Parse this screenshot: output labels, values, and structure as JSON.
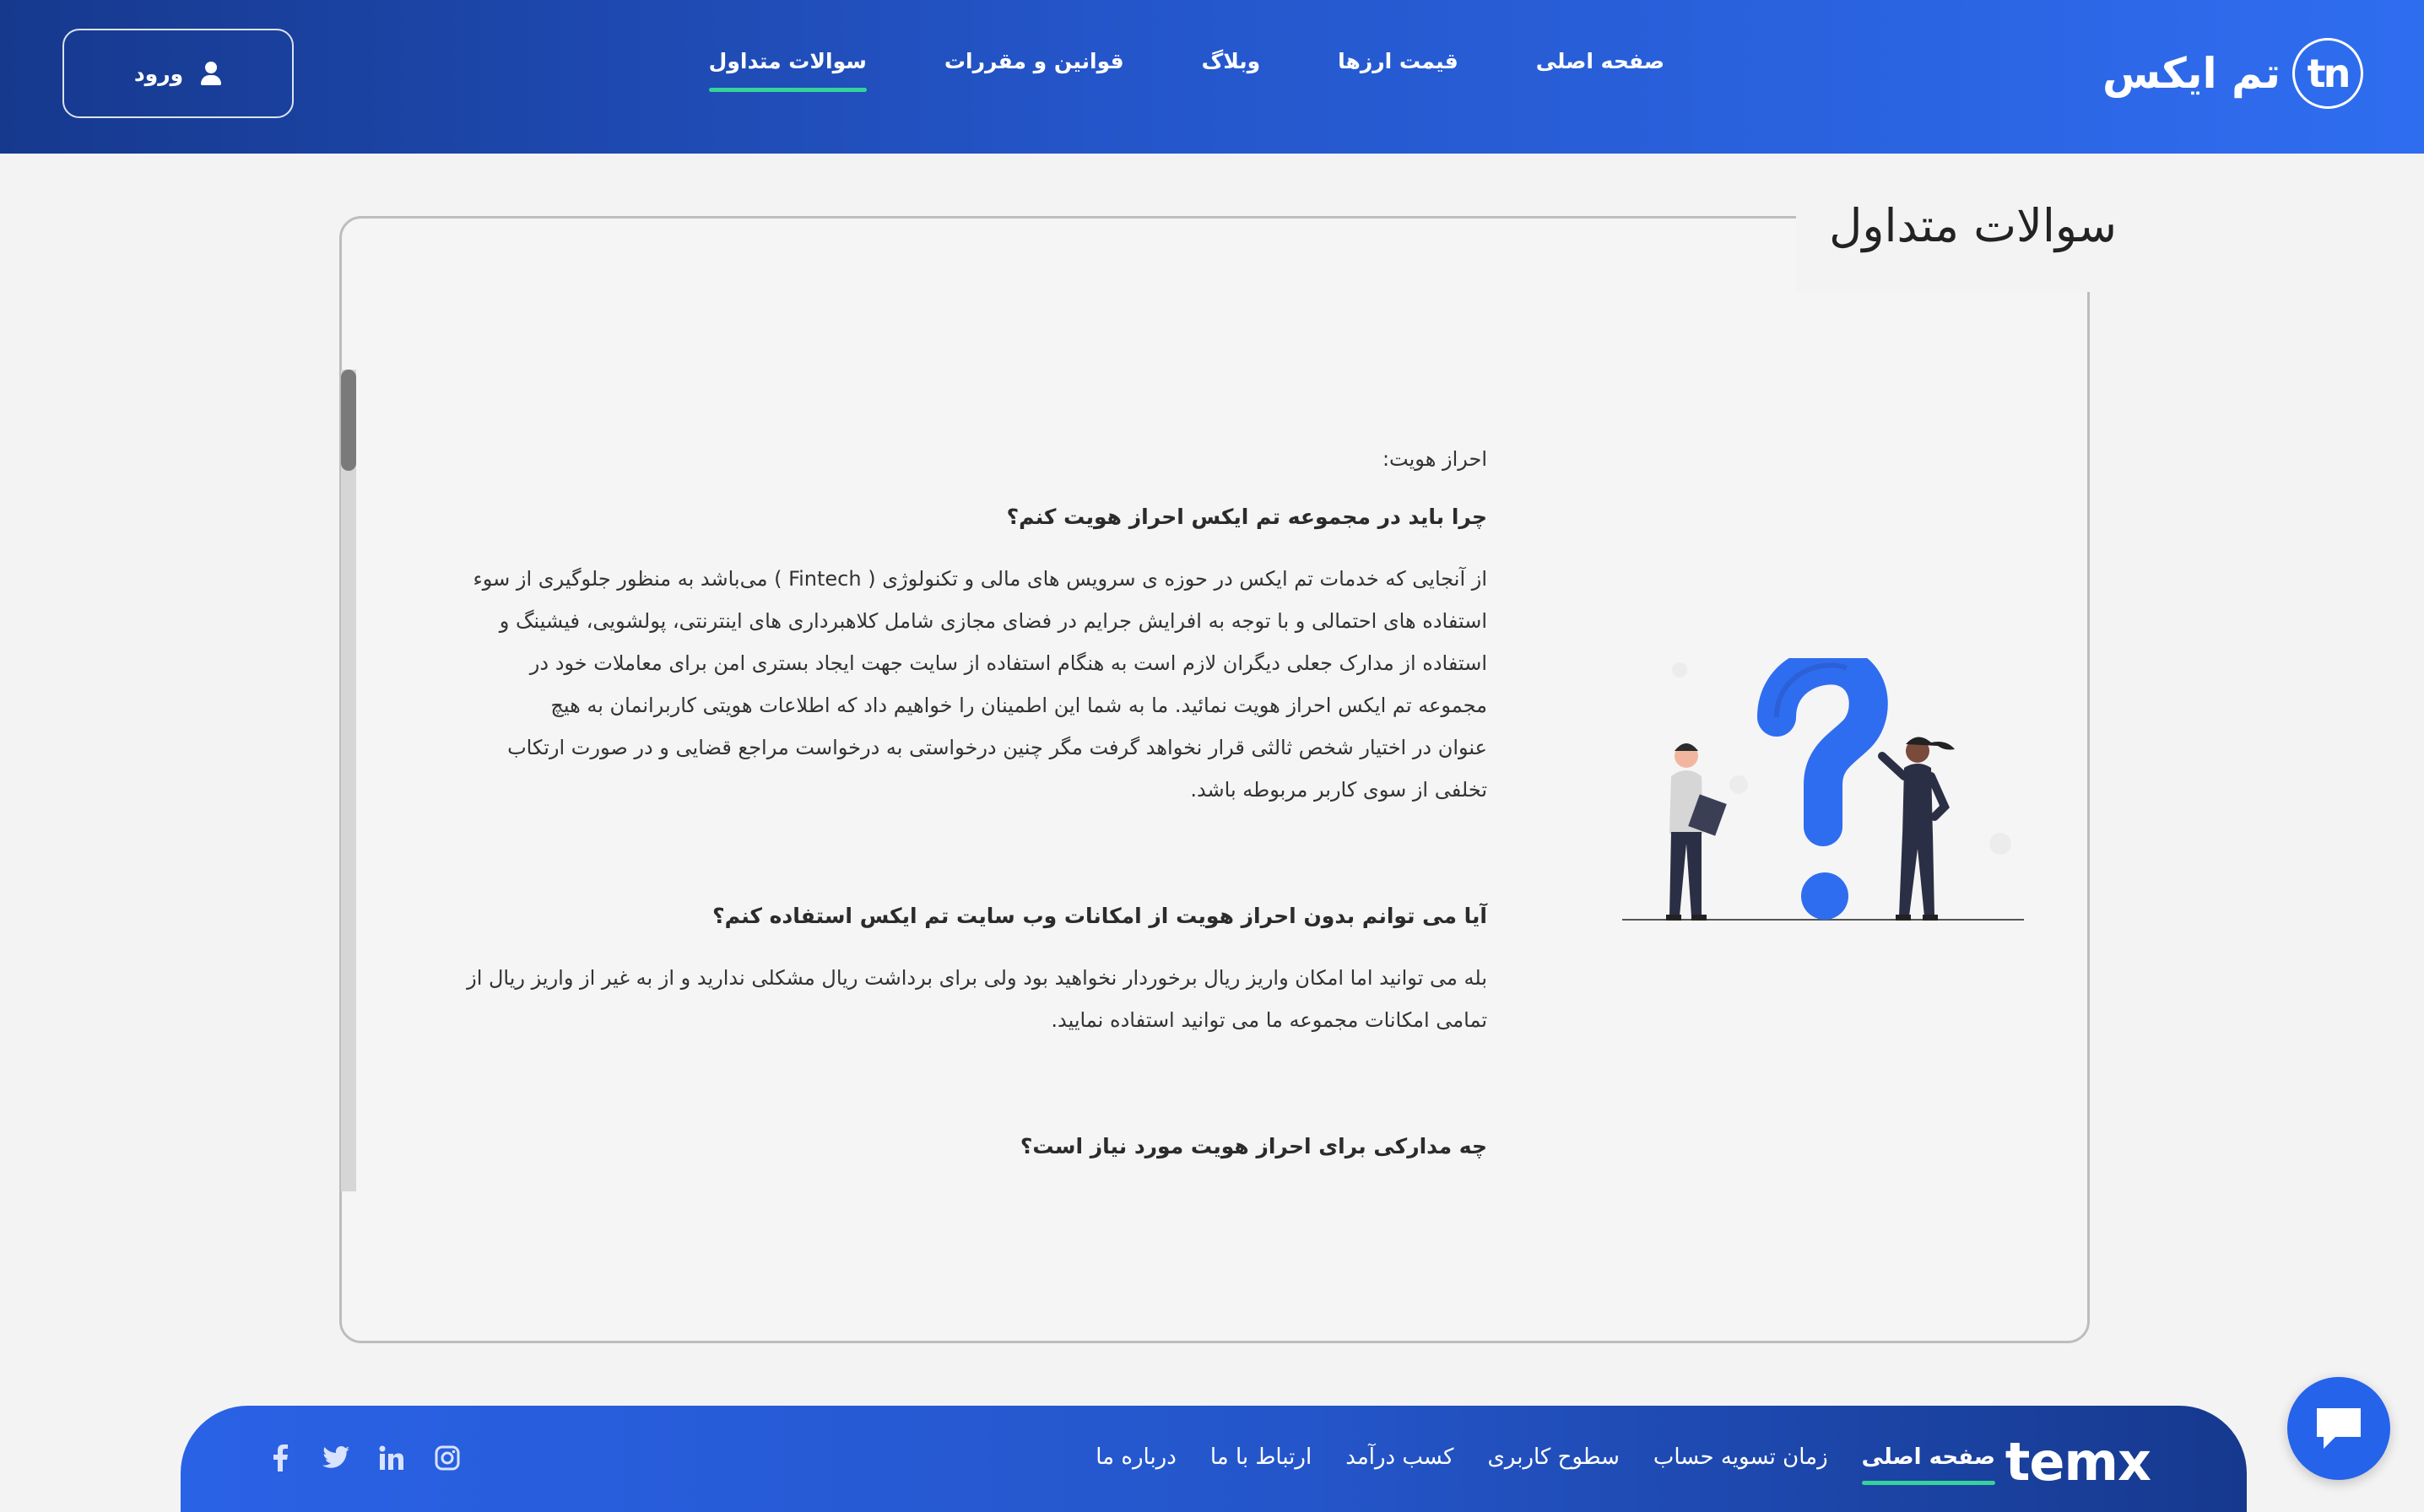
{
  "header": {
    "logo_text": "تم ایکس",
    "logo_mark": "tn",
    "nav": [
      {
        "label": "صفحه اصلی",
        "active": false
      },
      {
        "label": "قیمت ارزها",
        "active": false
      },
      {
        "label": "وبلاگ",
        "active": false
      },
      {
        "label": "قوانین و مقررات",
        "active": false
      },
      {
        "label": "سوالات متداول",
        "active": true
      }
    ],
    "login_label": "ورود",
    "accent_color": "#35d39a"
  },
  "main": {
    "title": "سوالات متداول",
    "section_label": "احراز هویت:",
    "faqs": [
      {
        "question": "چرا باید در مجموعه تم ایکس احراز هویت کنم؟",
        "answer_lines": [
          "از آنجایی که خدمات تم ایکس در حوزه ی سرویس های مالی و تکنولوژی ( Fintech ) می‌باشد به منظور جلوگیری از سوء",
          "استفاده های احتمالی و با توجه به افرایش جرایم در فضای مجازی شامل کلاهبرداری های اینترنتی، پولشویی، فیشینگ و",
          "استفاده از مدارک جعلی دیگران لازم است به هنگام استفاده از سایت جهت ایجاد بستری امن برای معاملات خود در",
          "مجموعه تم ایکس احراز هویت نمائید. ما به شما این اطمینان را خواهیم داد که اطلاعات هویتی کاربرانمان به هیچ",
          "عنوان در اختیار شخص ثالثی قرار نخواهد گرفت مگر چنین درخواستی به درخواست مراجع قضایی و در صورت ارتکاب",
          "تخلفی از سوی کاربر مربوطه باشد."
        ]
      },
      {
        "question": "آیا می توانم بدون احراز هویت از امکانات وب سایت تم ایکس استفاده کنم؟",
        "answer_lines": [
          "بله می توانید اما امکان واریز ریال برخوردار نخواهید بود ولی برای برداشت ریال مشکلی ندارید و از به غیر از واریز ریال از",
          "تمامی امکانات مجموعه ما می توانید استفاده نمایید."
        ]
      },
      {
        "question": "چه مدارکی برای احراز هویت مورد نیاز است؟",
        "answer_lines": []
      }
    ],
    "illustration_color": "#2f6df0"
  },
  "footer": {
    "logo_text": "temx",
    "nav": [
      {
        "label": "صفحه اصلی",
        "active": true
      },
      {
        "label": "زمان تسویه حساب",
        "active": false
      },
      {
        "label": "سطوح کاربری",
        "active": false
      },
      {
        "label": "کسب درآمد",
        "active": false
      },
      {
        "label": "ارتباط با ما",
        "active": false
      },
      {
        "label": "درباره ما",
        "active": false
      }
    ],
    "social": [
      "instagram-icon",
      "linkedin-icon",
      "twitter-icon",
      "facebook-icon"
    ]
  }
}
